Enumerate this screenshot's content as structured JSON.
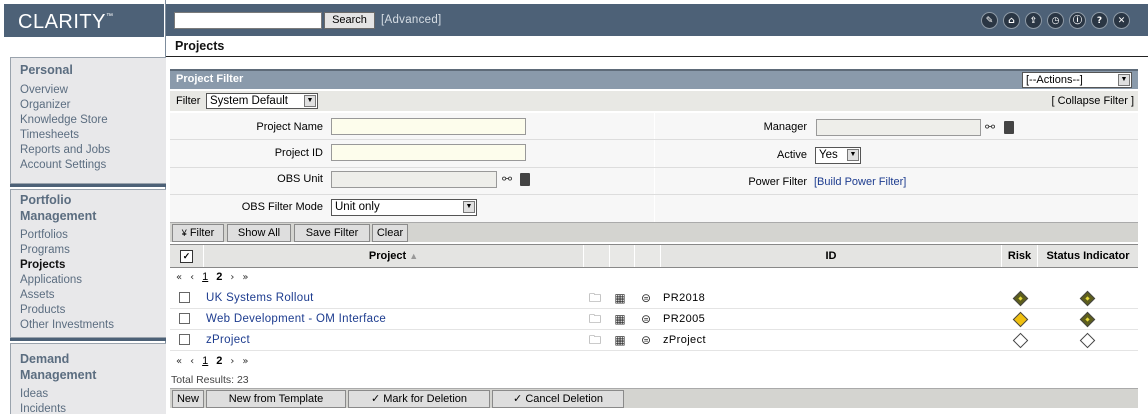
{
  "app": {
    "logo": "CLARITY",
    "logo_tm": "™"
  },
  "header": {
    "search_button": "Search",
    "advanced_link": "[Advanced]",
    "search_value": "",
    "icons": [
      "wrench-icon",
      "home-icon",
      "upload-icon",
      "clock-icon",
      "info-icon",
      "help-icon",
      "close-icon"
    ]
  },
  "sidebar": {
    "personal": {
      "title": "Personal",
      "items": [
        "Overview",
        "Organizer",
        "Knowledge Store",
        "Timesheets",
        "Reports and Jobs",
        "Account Settings"
      ]
    },
    "portfolio": {
      "title_line1": "Portfolio",
      "title_line2": "Management",
      "items": [
        "Portfolios",
        "Programs",
        "Projects",
        "Applications",
        "Assets",
        "Products",
        "Other Investments"
      ],
      "current": "Projects"
    },
    "demand": {
      "title_line1": "Demand",
      "title_line2": "Management",
      "items": [
        "Ideas",
        "Incidents"
      ]
    }
  },
  "page": {
    "title": "Projects"
  },
  "filter": {
    "panel_title": "Project Filter",
    "actions_value": "[--Actions--]",
    "filter_label": "Filter",
    "filter_value": "System Default",
    "collapse_link": "[ Collapse Filter ]",
    "fields": {
      "project_name_label": "Project Name",
      "project_id_label": "Project ID",
      "obs_unit_label": "OBS Unit",
      "obs_mode_label": "OBS Filter Mode",
      "obs_mode_value": "Unit only",
      "manager_label": "Manager",
      "active_label": "Active",
      "active_value": "Yes",
      "power_filter_label": "Power Filter",
      "power_filter_link": "[Build Power Filter]"
    },
    "buttons": {
      "filter": "Filter",
      "show_all": "Show All",
      "save_filter": "Save Filter",
      "clear": "Clear"
    }
  },
  "grid": {
    "columns": {
      "project": "Project",
      "id": "ID",
      "risk": "Risk",
      "status": "Status Indicator"
    },
    "pager": {
      "pages": [
        "1",
        "2"
      ],
      "current": "2"
    },
    "rows": [
      {
        "name": "UK Systems Rollout",
        "id": "PR2018",
        "risk": "olive",
        "status": "olive"
      },
      {
        "name": "Web Development - OM Interface",
        "id": "PR2005",
        "risk": "yellow",
        "status": "olive"
      },
      {
        "name": "zProject",
        "id": "zProject",
        "risk": "white",
        "status": "white"
      }
    ],
    "total_results": "Total Results: 23"
  },
  "bottom_buttons": {
    "new": "New",
    "new_from_template": "New from Template",
    "mark_deletion": "Mark for Deletion",
    "cancel_deletion": "Cancel Deletion"
  }
}
